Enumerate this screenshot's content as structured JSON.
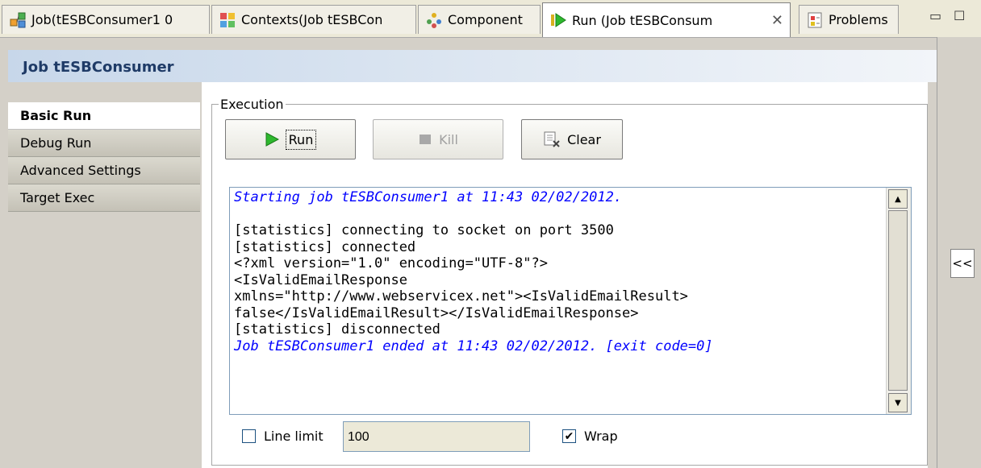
{
  "tabs": [
    {
      "label": "Job(tESBConsumer1 0",
      "icon": "job-icon"
    },
    {
      "label": "Contexts(Job tESBCon",
      "icon": "contexts-icon"
    },
    {
      "label": "Component",
      "icon": "component-icon"
    },
    {
      "label": "Run (Job tESBConsum",
      "icon": "run-icon",
      "active": true,
      "close": "✕"
    },
    {
      "label": "Problems",
      "icon": "problems-icon"
    }
  ],
  "window_controls": {
    "minimize": "▭",
    "maximize": "☐"
  },
  "header": {
    "title": "Job tESBConsumer"
  },
  "nav": {
    "items": [
      {
        "label": "Basic Run",
        "active": true
      },
      {
        "label": "Debug Run"
      },
      {
        "label": "Advanced Settings"
      },
      {
        "label": "Target Exec"
      }
    ]
  },
  "execution": {
    "legend": "Execution",
    "run_label": "Run",
    "kill_label": "Kill",
    "clear_label": "Clear"
  },
  "console": {
    "lines": [
      {
        "text": "Starting job tESBConsumer1 at 11:43 02/02/2012.",
        "style": "info"
      },
      {
        "text": "",
        "style": "normal"
      },
      {
        "text": "[statistics] connecting to socket on port 3500",
        "style": "normal"
      },
      {
        "text": "[statistics] connected",
        "style": "normal"
      },
      {
        "text": "<?xml version=\"1.0\" encoding=\"UTF-8\"?>",
        "style": "normal"
      },
      {
        "text": "<IsValidEmailResponse",
        "style": "normal"
      },
      {
        "text": "xmlns=\"http://www.webservicex.net\"><IsValidEmailResult>",
        "style": "normal"
      },
      {
        "text": "false</IsValidEmailResult></IsValidEmailResponse>",
        "style": "normal"
      },
      {
        "text": "[statistics] disconnected",
        "style": "normal"
      },
      {
        "text": "Job tESBConsumer1 ended at 11:43 02/02/2012. [exit code=0]",
        "style": "info"
      }
    ]
  },
  "options": {
    "line_limit_label": "Line limit",
    "line_limit_checked": false,
    "line_limit_value": "100",
    "wrap_label": "Wrap",
    "wrap_checked": true
  },
  "collapse_label": "<<",
  "colors": {
    "header_text": "#1f3b67",
    "console_info": "#0000ff",
    "run_icon_green": "#2eb82e"
  }
}
